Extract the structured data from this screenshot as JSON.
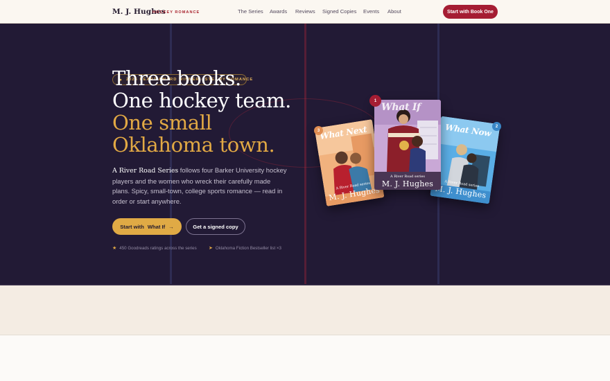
{
  "nav": {
    "brand": "M. J. Hughes",
    "brand_tag": "HOCKEY ROMANCE",
    "links": [
      "The Series",
      "Awards",
      "Reviews",
      "Signed Copies",
      "Events",
      "About"
    ],
    "cta": "Start with Book One"
  },
  "hero": {
    "award_badge": "2026 HEART AWARD WINNER · STEAMY ROMANCE",
    "headline_line1": "Three books.",
    "headline_line2": "One hockey team.",
    "headline_line3": "One small",
    "headline_line4": "Oklahoma town.",
    "lede_series": "A River Road Series",
    "lede_rest": " follows four Barker University hockey players and the women who wreck their carefully made plans. Spicy, small-town, college sports romance — read in order or start anywhere.",
    "primary_cta_prefix": "Start with",
    "primary_cta_title": "What If",
    "secondary_cta": "Get a signed copy",
    "proof_ratings": "450 Goodreads ratings across the series",
    "proof_bestseller": "Oklahoma Fiction Bestseller list ×3"
  },
  "books": [
    {
      "title": "What If",
      "series": "A River Road series",
      "author": "M. J. Hughes",
      "order": "1"
    },
    {
      "title": "What Now",
      "series": "A River Road series",
      "author": "M. J. Hughes",
      "order": "2"
    },
    {
      "title": "What Next",
      "series": "A River Road series",
      "author": "M. J. Hughes",
      "order": "3"
    }
  ],
  "colors": {
    "hero_bg": "#221a35",
    "accent_red": "#a51d33",
    "accent_gold": "#e0aa45",
    "page_bg": "#fbf7f1"
  }
}
